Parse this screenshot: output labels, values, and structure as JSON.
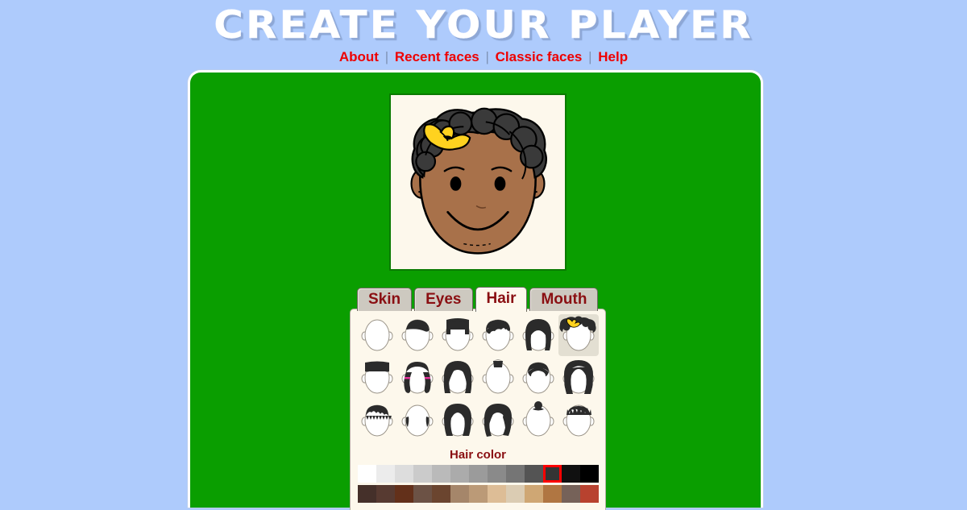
{
  "header": {
    "title": "CREATE YOUR PLAYER",
    "nav": [
      {
        "label": "About"
      },
      {
        "label": "Recent faces"
      },
      {
        "label": "Classic faces"
      },
      {
        "label": "Help"
      }
    ],
    "separator": "|"
  },
  "colors": {
    "background": "#aecbfc",
    "stage_green": "#0a9e00",
    "panel_cream": "#fdf8ec",
    "link_red": "#ee0000",
    "tab_text": "#8a0f12",
    "tab_inactive": "#cdc9c0",
    "selection_outline": "#ff0000",
    "thumb_selected_bg": "#e3dfd2"
  },
  "preview": {
    "name": "face-preview",
    "skin": "#a8714a",
    "skin_shadow": "#8d5c3a",
    "hair": "#3a3a3a",
    "hair_dark": "#2b2b2b",
    "accessory": "yellow-bow",
    "accessory_color": "#ffd21f",
    "eye_color": "#000000",
    "background": "#fdf8ec"
  },
  "tabs": [
    {
      "label": "Skin",
      "active": false
    },
    {
      "label": "Eyes",
      "active": false
    },
    {
      "label": "Hair",
      "active": true
    },
    {
      "label": "Mouth",
      "active": false
    }
  ],
  "picker": {
    "hair_color_label": "Hair color",
    "hairstyles": [
      {
        "id": "bald",
        "name": "bald",
        "selected": false
      },
      {
        "id": "short-side-part",
        "name": "short-side-part",
        "selected": false
      },
      {
        "id": "flat-top",
        "name": "flat-top",
        "selected": false
      },
      {
        "id": "wavy-short",
        "name": "wavy-short",
        "selected": false
      },
      {
        "id": "long-bob",
        "name": "long-bob",
        "selected": false
      },
      {
        "id": "curly-with-bow",
        "name": "curly-with-bow",
        "selected": true
      },
      {
        "id": "straight-bangs",
        "name": "straight-bangs",
        "selected": false
      },
      {
        "id": "pigtails",
        "name": "pigtails",
        "selected": false
      },
      {
        "id": "long-wavy",
        "name": "long-wavy",
        "selected": false
      },
      {
        "id": "top-tuft",
        "name": "top-tuft",
        "selected": false
      },
      {
        "id": "receding-short",
        "name": "receding-short",
        "selected": false
      },
      {
        "id": "big-wavy-long",
        "name": "big-wavy-long",
        "selected": false
      },
      {
        "id": "spiky-short",
        "name": "spiky-short",
        "selected": false
      },
      {
        "id": "balding-sides",
        "name": "balding-sides",
        "selected": false
      },
      {
        "id": "long-parted",
        "name": "long-parted",
        "selected": false
      },
      {
        "id": "asymmetric-bob",
        "name": "asymmetric-bob",
        "selected": false
      },
      {
        "id": "top-bun",
        "name": "top-bun",
        "selected": false
      },
      {
        "id": "spiky-punk",
        "name": "spiky-punk",
        "selected": false
      }
    ],
    "color_rows": [
      {
        "name": "grayscale-row",
        "swatches": [
          "#ffffff",
          "#ececec",
          "#dddddd",
          "#cbcbcb",
          "#bababa",
          "#ababab",
          "#9b9b9b",
          "#8a8a8a",
          "#757575",
          "#545454",
          "#343434",
          "#101010",
          "#000000"
        ],
        "selected_index": 10
      },
      {
        "name": "brown-row",
        "swatches": [
          "#45302a",
          "#573a31",
          "#63301a",
          "#6c5245",
          "#6b452f",
          "#a5866a",
          "#bb9a77",
          "#ddbd96",
          "#dbccb3",
          "#cfa774",
          "#b07642",
          "#766259",
          "#b8422f"
        ],
        "selected_index": -1
      }
    ]
  }
}
